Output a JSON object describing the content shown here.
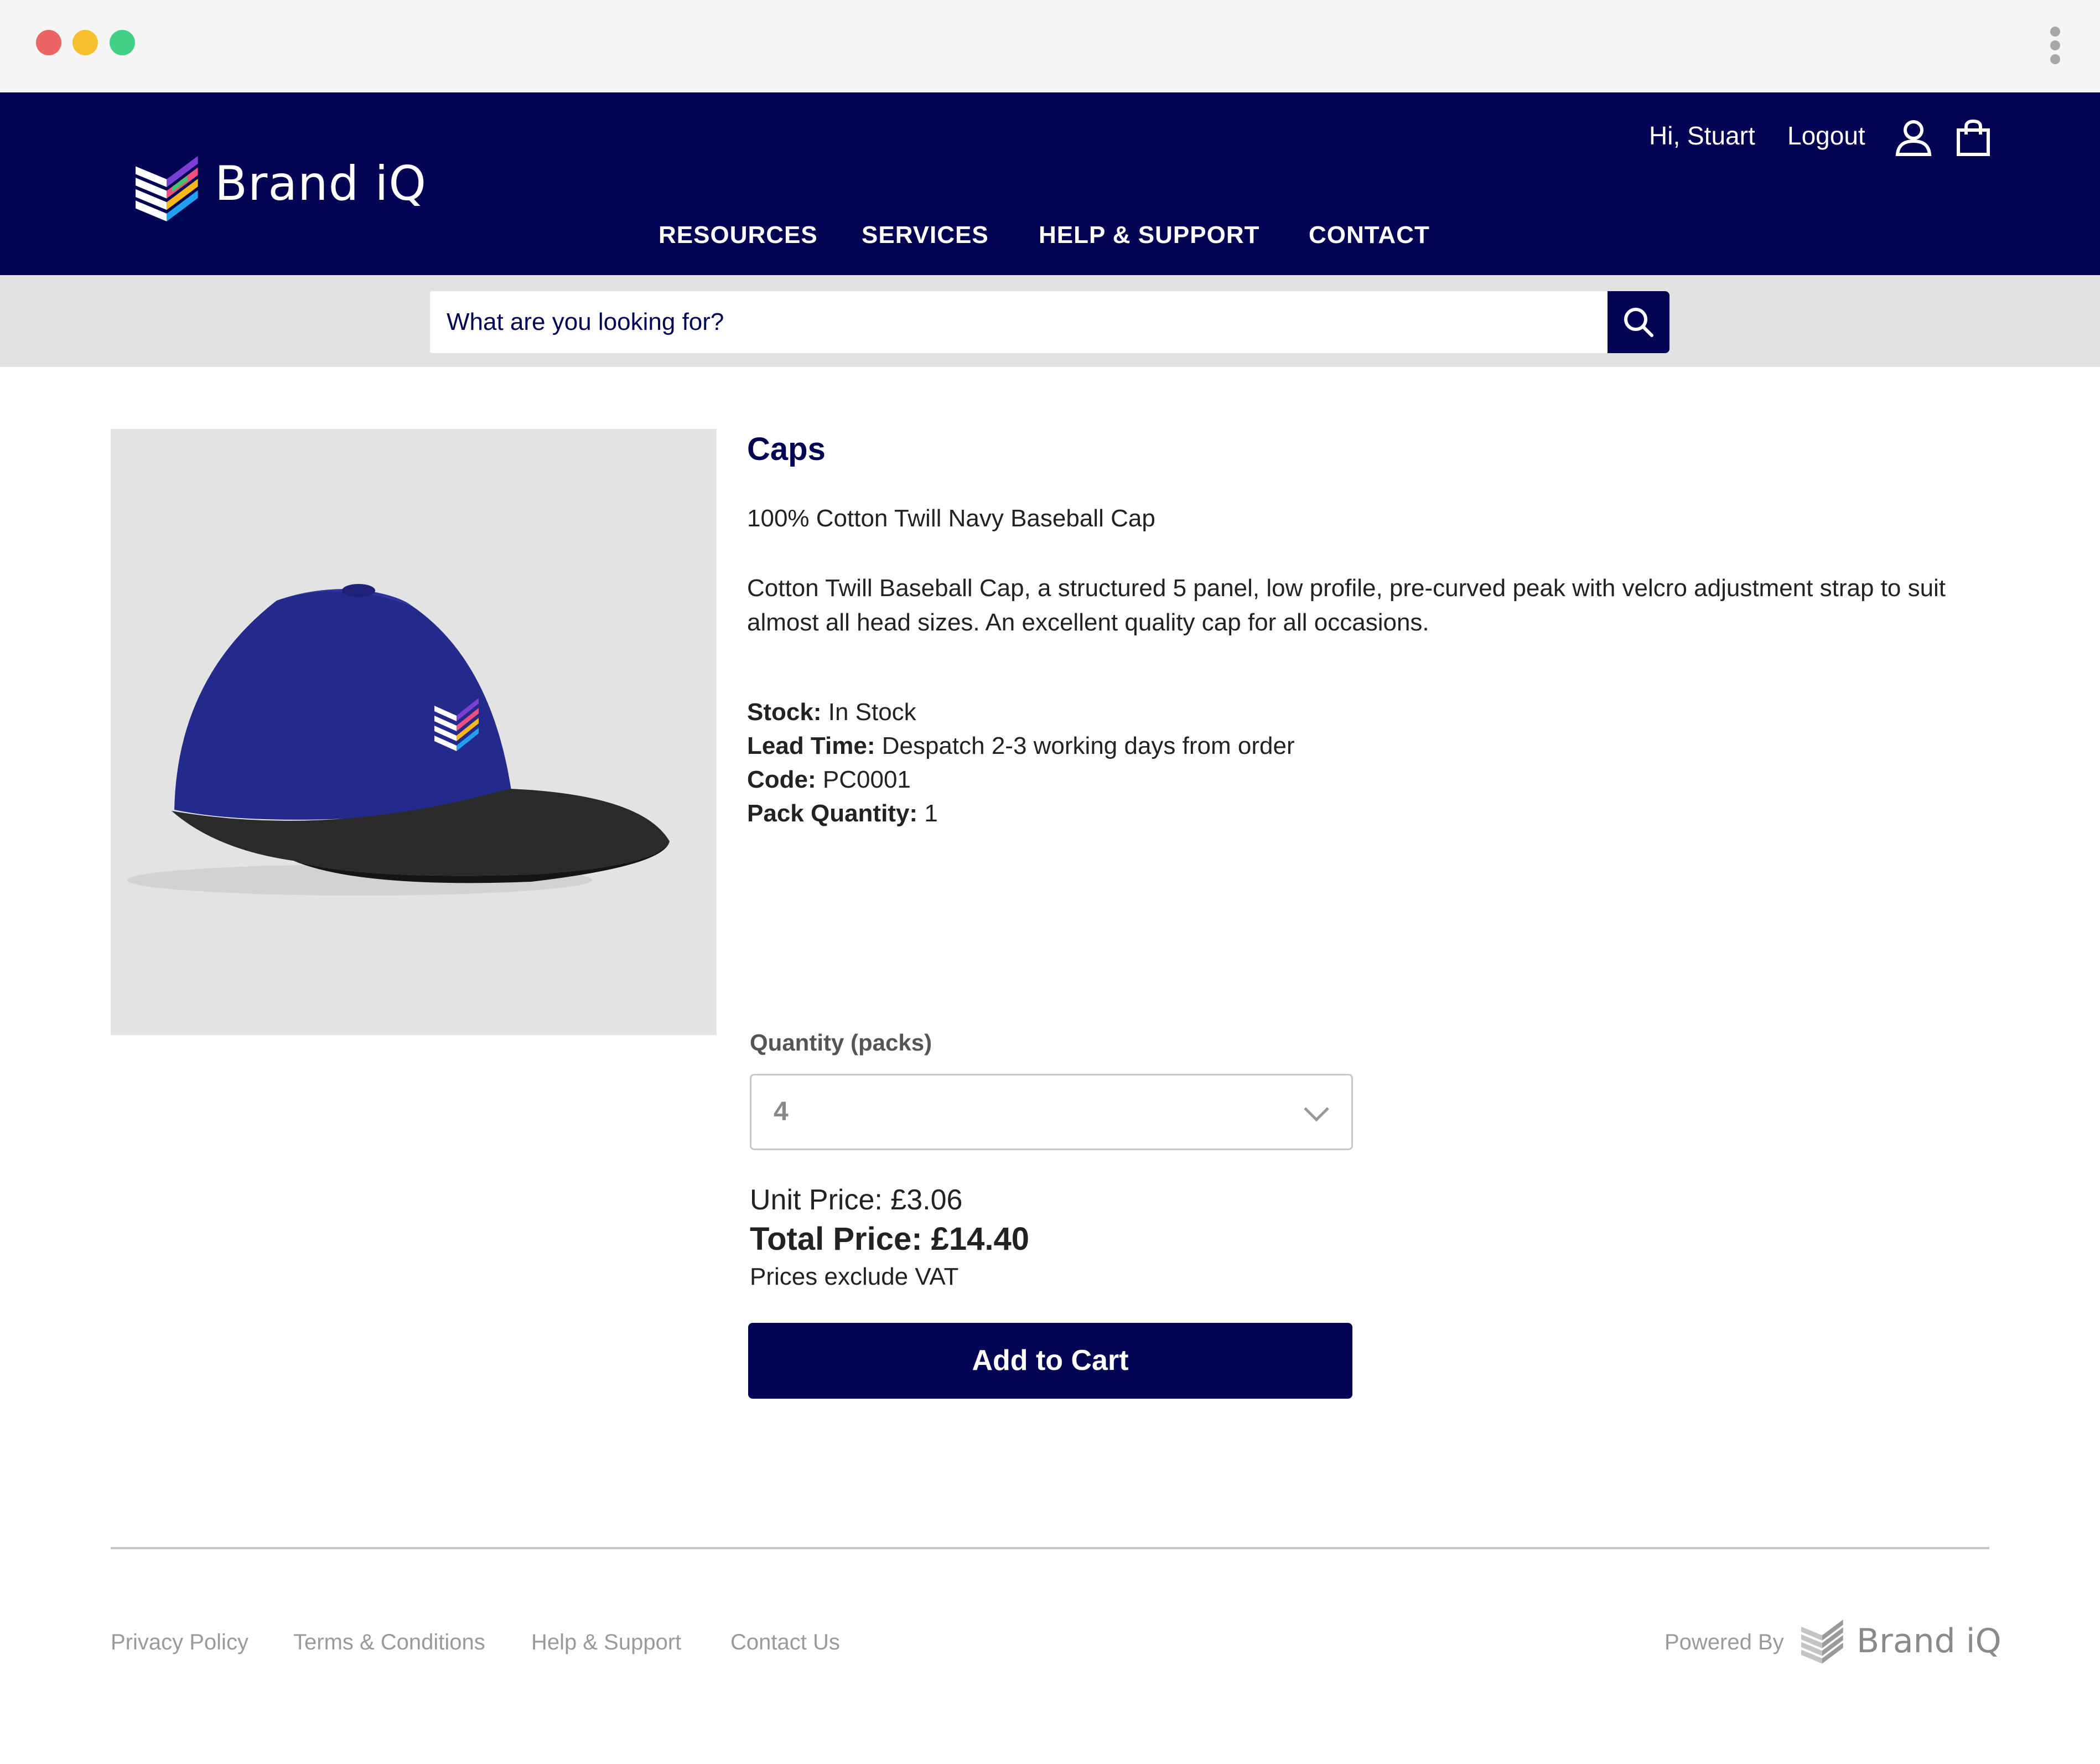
{
  "header": {
    "brand": "Brand iQ",
    "greeting": "Hi, Stuart",
    "logout": "Logout",
    "nav": [
      "RESOURCES",
      "SERVICES",
      "HELP & SUPPORT",
      "CONTACT"
    ],
    "icons": {
      "user": "user-icon",
      "cart": "shopping-bag-icon"
    }
  },
  "search": {
    "placeholder": "What are you looking for?",
    "icon": "search-icon"
  },
  "product": {
    "title": "Caps",
    "subtitle": "100% Cotton Twill Navy Baseball Cap",
    "description": "Cotton Twill Baseball Cap, a structured 5 panel, low profile, pre-curved peak with velcro adjustment strap to suit almost all head sizes.  An excellent quality cap for all occasions.",
    "specs": [
      {
        "label": "Stock:",
        "value": "In Stock"
      },
      {
        "label": "Lead Time:",
        "value": "Despatch 2-3 working days from order"
      },
      {
        "label": "Code:",
        "value": "PC0001"
      },
      {
        "label": "Pack Quantity:",
        "value": "1"
      }
    ]
  },
  "purchase": {
    "qty_label": "Quantity (packs)",
    "qty_value": "4",
    "unit_price": "Unit Price:  £3.06",
    "total_price": "Total Price: £14.40",
    "vat_note": "Prices exclude VAT",
    "add_to_cart": "Add to Cart"
  },
  "footer": {
    "links": [
      "Privacy Policy",
      "Terms & Conditions",
      "Help & Support",
      "Contact Us"
    ],
    "powered_by": "Powered By",
    "brand": "Brand iQ"
  },
  "colors": {
    "navy": "#020553",
    "search_bg": "#e2e2e2",
    "image_bg": "#e3e3e3"
  }
}
